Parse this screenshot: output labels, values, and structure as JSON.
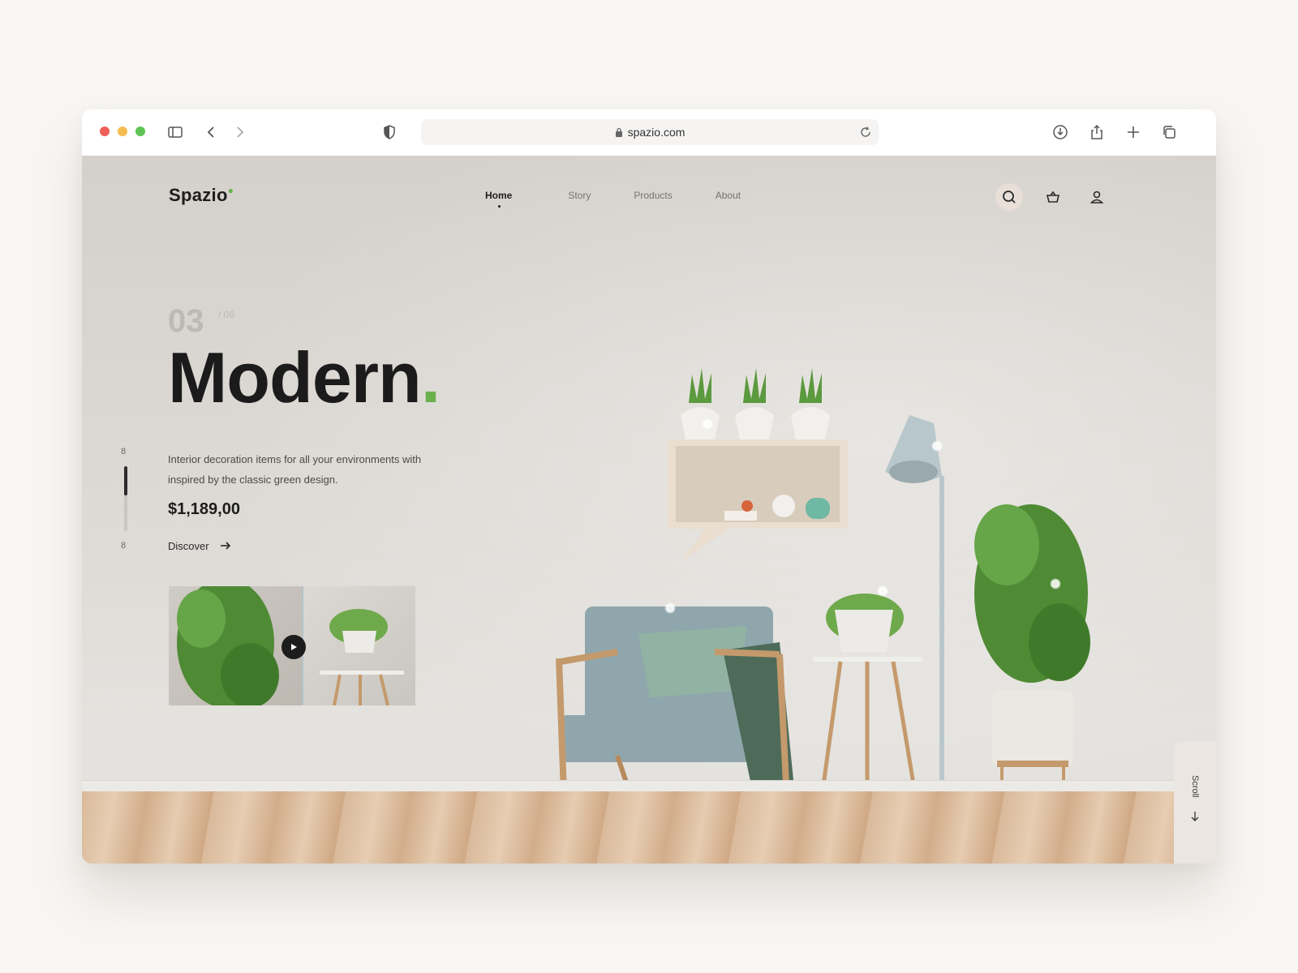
{
  "browser": {
    "url": "spazio.com"
  },
  "site": {
    "logo": "Spazio",
    "nav": [
      {
        "label": "Home",
        "active": true
      },
      {
        "label": "Story",
        "active": false
      },
      {
        "label": "Products",
        "active": false
      },
      {
        "label": "About",
        "active": false
      }
    ]
  },
  "hero": {
    "counter_current": "03",
    "counter_total": "/ 06",
    "headline": "Modern",
    "headline_dot": ".",
    "description": "Interior decoration items for all your environments with inspired by the classic green design.",
    "price": "$1,189,00",
    "cta": "Discover",
    "slider_top_label": "8",
    "slider_bottom_label": "8",
    "slider_progress": 0.45
  },
  "scroll": {
    "label": "Scroll"
  },
  "icons": {
    "sidebar": "sidebar-icon",
    "back": "chevron-left-icon",
    "forward": "chevron-right-icon",
    "shield": "shield-icon",
    "lock": "lock-icon",
    "reload": "reload-icon",
    "download": "download-icon",
    "share": "share-icon",
    "new_tab": "plus-icon",
    "tabs": "tabs-icon",
    "search": "search-icon",
    "cart": "basket-icon",
    "user": "user-icon",
    "arrow": "arrow-right-icon",
    "play": "play-icon"
  },
  "colors": {
    "accent": "#6ab04c",
    "text": "#1d1d1d",
    "muted": "#bdb9b3",
    "wall": "#dad7d2"
  }
}
